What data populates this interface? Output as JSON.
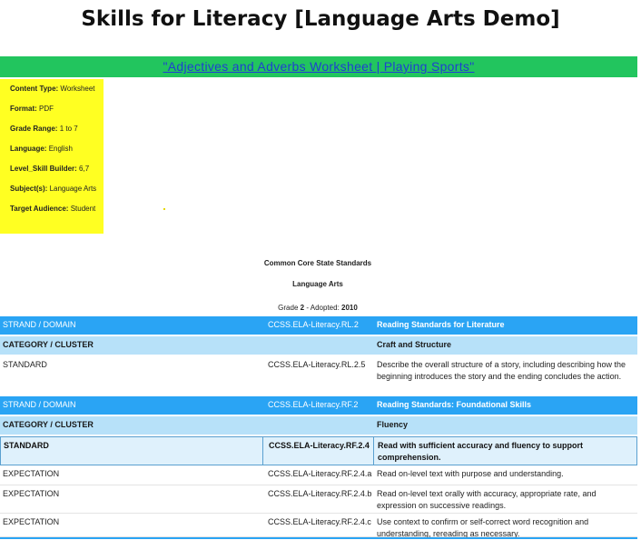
{
  "page": {
    "title": "Skills for Literacy [Language Arts Demo]",
    "resource_link": "\"Adjectives and Adverbs Worksheet | Playing Sports\""
  },
  "metadata": [
    {
      "label": "Content Type:",
      "value": "Worksheet"
    },
    {
      "label": "Format:",
      "value": "PDF"
    },
    {
      "label": "Grade Range:",
      "value": "1 to 7"
    },
    {
      "label": "Language:",
      "value": "English"
    },
    {
      "label": "Level_Skill Builder:",
      "value": "6,7"
    },
    {
      "label": "Subject(s):",
      "value": "Language Arts"
    },
    {
      "label": "Target Audience:",
      "value": "Student"
    }
  ],
  "standards_header": {
    "line1": "Common Core State Standards",
    "line2": "Language Arts",
    "grade_prefix": "Grade",
    "grade": "2",
    "adopted_prefix": " - Adopted: ",
    "adopted_year": "2010"
  },
  "rows": [
    {
      "type": "strand",
      "col1": "STRAND / DOMAIN",
      "col2": "CCSS.ELA-Literacy.RL.2",
      "col3": "Reading Standards for Literature"
    },
    {
      "type": "category",
      "col1": "CATEGORY / CLUSTER",
      "col2": "",
      "col3": "Craft and Structure"
    },
    {
      "type": "standard-plain",
      "col1": "STANDARD",
      "col2": "CCSS.ELA-Literacy.RL.2.5",
      "col3": "Describe the overall structure of a story, including describing how the beginning introduces the story and the ending concludes the action."
    },
    {
      "type": "strand",
      "col1": "STRAND / DOMAIN",
      "col2": "CCSS.ELA-Literacy.RF.2",
      "col3": "Reading Standards: Foundational Skills"
    },
    {
      "type": "category",
      "col1": "CATEGORY / CLUSTER",
      "col2": "",
      "col3": "Fluency"
    },
    {
      "type": "standard-hl",
      "col1": "STANDARD",
      "col2": "CCSS.ELA-Literacy.RF.2.4",
      "col3": "Read with sufficient accuracy and fluency to support comprehension."
    },
    {
      "type": "expect",
      "col1": "EXPECTATION",
      "col2": "CCSS.ELA-Literacy.RF.2.4.a",
      "col3": "Read on-level text with purpose and understanding."
    },
    {
      "type": "expect",
      "col1": "EXPECTATION",
      "col2": "CCSS.ELA-Literacy.RF.2.4.b",
      "col3": "Read on-level text orally with accuracy, appropriate rate, and expression on successive readings."
    },
    {
      "type": "expect",
      "col1": "EXPECTATION",
      "col2": "CCSS.ELA-Literacy.RF.2.4.c",
      "col3": "Use context to confirm or self-correct word recognition and understanding, rereading as necessary."
    }
  ]
}
